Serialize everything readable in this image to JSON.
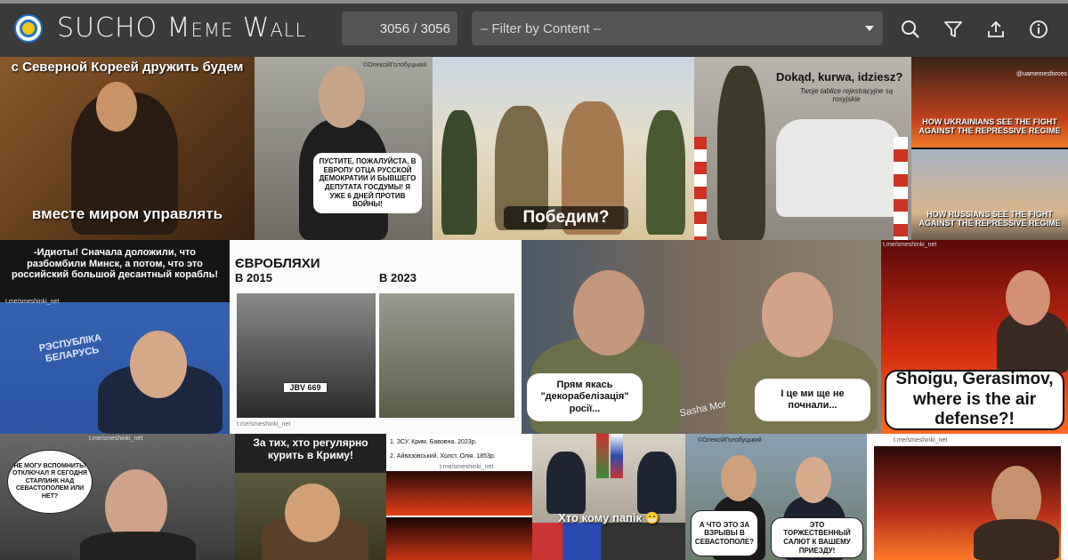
{
  "header": {
    "title_main": "SUCHO",
    "title_rest": "Meme Wall",
    "counter": "3056 / 3056",
    "filter_placeholder": "– Filter by Content –",
    "icons": [
      "search-icon",
      "filter-icon",
      "upload-icon",
      "info-icon"
    ]
  },
  "memes": {
    "m1": {
      "top": "с Северной Кореей дружить будем",
      "bottom": "вместе миром управлять"
    },
    "m2": {
      "bubble": "ПУСТИТЕ, ПОЖАЛУЙСТА, В ЕВРОПУ ОТЦА РУССКОЙ ДЕМОКРАТИИ И БЫВШЕГО ДЕПУТАТА ГОСДУМЫ! Я УЖЕ 6 ДНЕЙ ПРОТИВ ВОЙНЫ!",
      "watermark": "©ОлексійГолобуцький"
    },
    "m3": {
      "caption": "Победим?"
    },
    "m4": {
      "title": "Dokąd, kurwa, idziesz?",
      "subtitle": "Twoje tablice rejestracyjne są rosyjskie"
    },
    "m5": {
      "top": "HOW UKRAINIANS SEE THE FIGHT AGAINST THE REPRESSIVE REGIME",
      "bottom": "HOW RUSSIANS SEE THE FIGHT AGAINST THE REPRESSIVE REGIME",
      "handle": "@uamemesforces"
    },
    "m6": {
      "text": "-Идиоты! Сначала доложили, что разбомбили Минск, а потом, что это российский большой десантный корабль!",
      "watermark": "t.me/smeshinki_net",
      "banner": "РЭСПУБЛІКА БЕЛАРУСЬ"
    },
    "m7": {
      "title": "ЄВРОБЛЯХИ",
      "left": "В 2015",
      "right": "В 2023",
      "plate": "JBV 669",
      "watermark": "t.me/smeshinki_net"
    },
    "m8": {
      "left": "Прям якась \"декорабелізація\" росії...",
      "right": "І це ми ще не почнали...",
      "signature": "Sasha Mor"
    },
    "m9": {
      "bubble": "Shoigu, Gerasimov, where is the air defense?!",
      "watermark": "t.me/smeshinki_net"
    },
    "m10": {
      "bubble": "НЕ МОГУ ВСПОМНИТЬ! ОТКЛЮЧАЛ Я СЕГОДНЯ СТАРЛИНК НАД СЕВАСТОПОЛЕМ ИЛИ НЕТ?",
      "watermark": "t.me/smeshinki_net"
    },
    "m11": {
      "caption": "За тих, хто регулярно курить в Криму!"
    },
    "m12": {
      "line1": "1. ЗСУ. Крим. Бавовна. 2023р.",
      "line2": "2. Айвазовський. Холст. Олія. 1853р.",
      "watermark": "t.me/smeshinki_net"
    },
    "m13": {
      "caption": "Хто кому папік 😁"
    },
    "m14": {
      "left": "А ЧТО ЭТО ЗА ВЗРЫВЫ В СЕВАСТОПОЛЕ?",
      "right": "ЭТО ТОРЖЕСТВЕННЫЙ САЛЮТ К ВАШЕМУ ПРИЕЗДУ!",
      "watermark": "©ОлексійГолобуцький"
    },
    "m15": {
      "watermark": "t.me/smeshinki_net"
    }
  }
}
